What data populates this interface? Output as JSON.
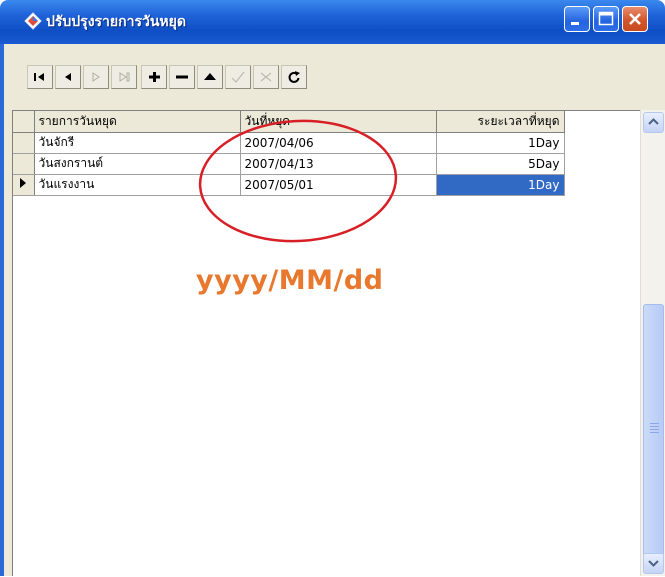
{
  "window": {
    "title": "ปรับปรุงรายการวันหยุด",
    "icon": "diamond-app-icon",
    "controls": [
      "minimize-icon",
      "maximize-icon",
      "close-icon"
    ],
    "colors": {
      "titlebar": "#1f62d8",
      "close": "#d2562c",
      "selection": "#316ac5",
      "annotation_text": "#e8782e",
      "annotation_circle": "#d81f26"
    }
  },
  "toolbar": {
    "buttons": [
      {
        "name": "first-record",
        "icon": "first-record-icon",
        "enabled": true
      },
      {
        "name": "prior-record",
        "icon": "prior-record-icon",
        "enabled": true
      },
      {
        "name": "next-record",
        "icon": "next-record-icon",
        "enabled": false
      },
      {
        "name": "last-record",
        "icon": "last-record-icon",
        "enabled": false
      },
      {
        "name": "insert-record",
        "icon": "plus-icon",
        "enabled": true
      },
      {
        "name": "delete-record",
        "icon": "minus-icon",
        "enabled": true
      },
      {
        "name": "edit-record",
        "icon": "edit-triangle-icon",
        "enabled": true
      },
      {
        "name": "post-edit",
        "icon": "checkmark-icon",
        "enabled": false
      },
      {
        "name": "cancel-edit",
        "icon": "x-icon",
        "enabled": false
      },
      {
        "name": "refresh-data",
        "icon": "refresh-icon",
        "enabled": true
      }
    ]
  },
  "grid": {
    "columns": [
      "รายการวันหยุด",
      "วันที่หยุด",
      "ระยะเวลาที่หยุด"
    ],
    "rows": [
      {
        "name": "วันจักรี",
        "date": "2007/04/06",
        "duration": "1Day"
      },
      {
        "name": "วันสงกรานต์",
        "date": "2007/04/13",
        "duration": "5Day"
      },
      {
        "name": "วันแรงงาน",
        "date": "2007/05/01",
        "duration": "1Day"
      }
    ],
    "current_row": 3,
    "selected_cell": "duration"
  },
  "annotation": {
    "format_text": "yyyy/MM/dd"
  }
}
